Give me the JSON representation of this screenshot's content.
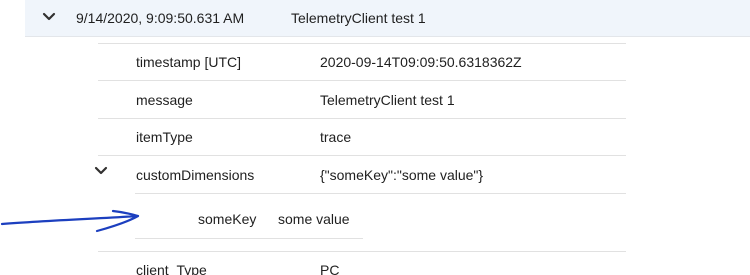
{
  "result": {
    "timestamp_display": "9/14/2020, 9:09:50.631 AM",
    "message": "TelemetryClient test 1",
    "expand_icon": "chevron-down-icon"
  },
  "details": [
    {
      "key": "timestamp [UTC]",
      "value": "2020-09-14T09:09:50.6318362Z"
    },
    {
      "key": "message",
      "value": "TelemetryClient test 1"
    },
    {
      "key": "itemType",
      "value": "trace"
    },
    {
      "key": "customDimensions",
      "value": "{\"someKey\":\"some value\"}",
      "expand_icon": "chevron-down-icon"
    },
    {
      "key": "client_Type",
      "value": "PC"
    }
  ],
  "custom_dimensions": [
    {
      "key": "someKey",
      "value": "some value"
    }
  ],
  "annotation": {
    "icon": "hand-drawn-arrow-icon",
    "color": "#1c3fbf"
  },
  "colors": {
    "header_background": "#f0f5fb",
    "divider": "#e1e1e1"
  }
}
